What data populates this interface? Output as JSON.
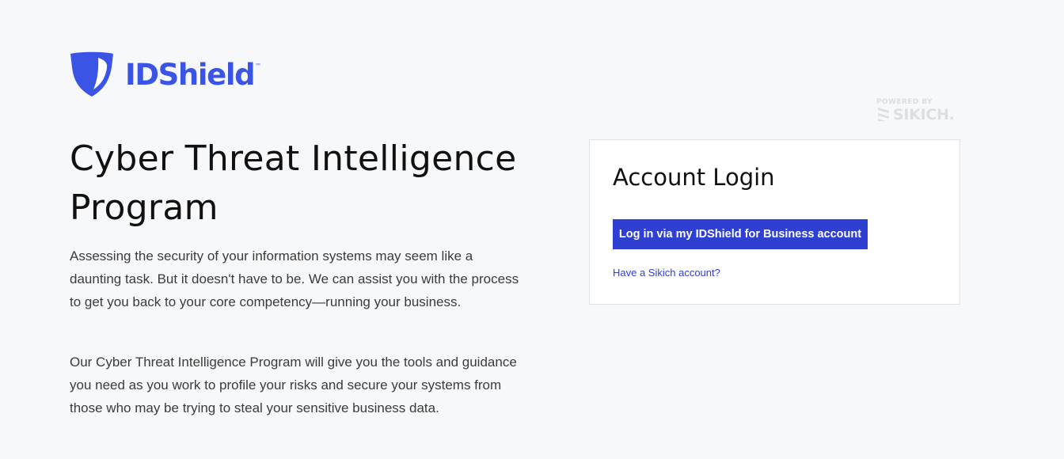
{
  "brand": {
    "logo_icon": "shield-icon",
    "name": "IDShield",
    "trademark": "™",
    "color": "#3a55e6"
  },
  "powered_by": {
    "label": "POWERED BY",
    "brand": "SIKICH.",
    "icon": "sikich-logo-icon"
  },
  "hero": {
    "title": "Cyber Threat Intelligence Program",
    "paragraphs": [
      "Assessing the security of your information systems may seem like a daunting task. But it doesn't have to be. We can assist you with the process to get you back to your core competency—running your business.",
      "Our Cyber Threat Intelligence Program will give you the tools and guidance you need as you work to profile your risks and secure your systems from those who may be trying to steal your sensitive business data."
    ]
  },
  "login": {
    "title": "Account Login",
    "button_label": "Log in via my IDShield for Business account",
    "alt_link": "Have a Sikich account?",
    "accent_color": "#2f3fd1"
  }
}
